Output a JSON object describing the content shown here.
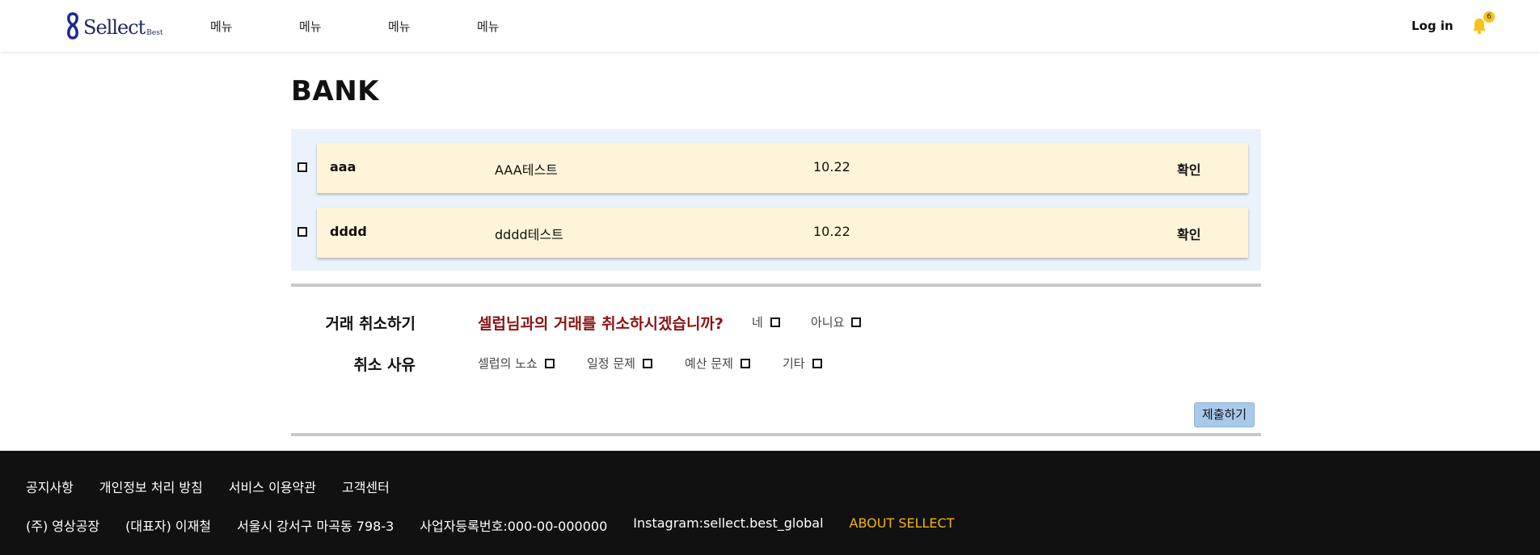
{
  "header": {
    "logo_text": "Sellect",
    "logo_sub": "Best",
    "nav": [
      "메뉴",
      "메뉴",
      "메뉴",
      "메뉴"
    ],
    "login_label": "Log in",
    "notification_count": "6",
    "bell_color": "#f7c31a"
  },
  "page": {
    "title": "BANK"
  },
  "rows": [
    {
      "name": "aaa",
      "desc": "AAA테스트",
      "date": "10.22",
      "action": "확인"
    },
    {
      "name": "dddd",
      "desc": "dddd테스트",
      "date": "10.22",
      "action": "확인"
    }
  ],
  "cancel_form": {
    "cancel_label": "거래 취소하기",
    "question": "셀럽님과의 거래를 취소하시겠습니까?",
    "yes": "네",
    "no": "아니요",
    "reason_label": "취소 사유",
    "reasons": [
      "셀럽의 노쇼",
      "일정 문제",
      "예산 문제",
      "기타"
    ],
    "submit_label": "제출하기"
  },
  "footer": {
    "links": [
      "공지사항",
      "개인정보 처리 방침",
      "서비스 이용약관",
      "고객센터"
    ],
    "company": "(주) 영상공장",
    "ceo": "(대표자) 이재철",
    "address": "서울시 강서구 마곡동 798-3",
    "business_no": "사업자등록번호:000-00-000000",
    "instagram": "Instagram:sellect.best_global",
    "about": "ABOUT SELLECT"
  },
  "colors": {
    "row_bg": "#fdf4d9",
    "list_bg": "#eaf2fb",
    "question": "#8b1313",
    "submit_bg": "#a9c9eb",
    "footer_bg": "#111111",
    "about": "#f4b400"
  }
}
